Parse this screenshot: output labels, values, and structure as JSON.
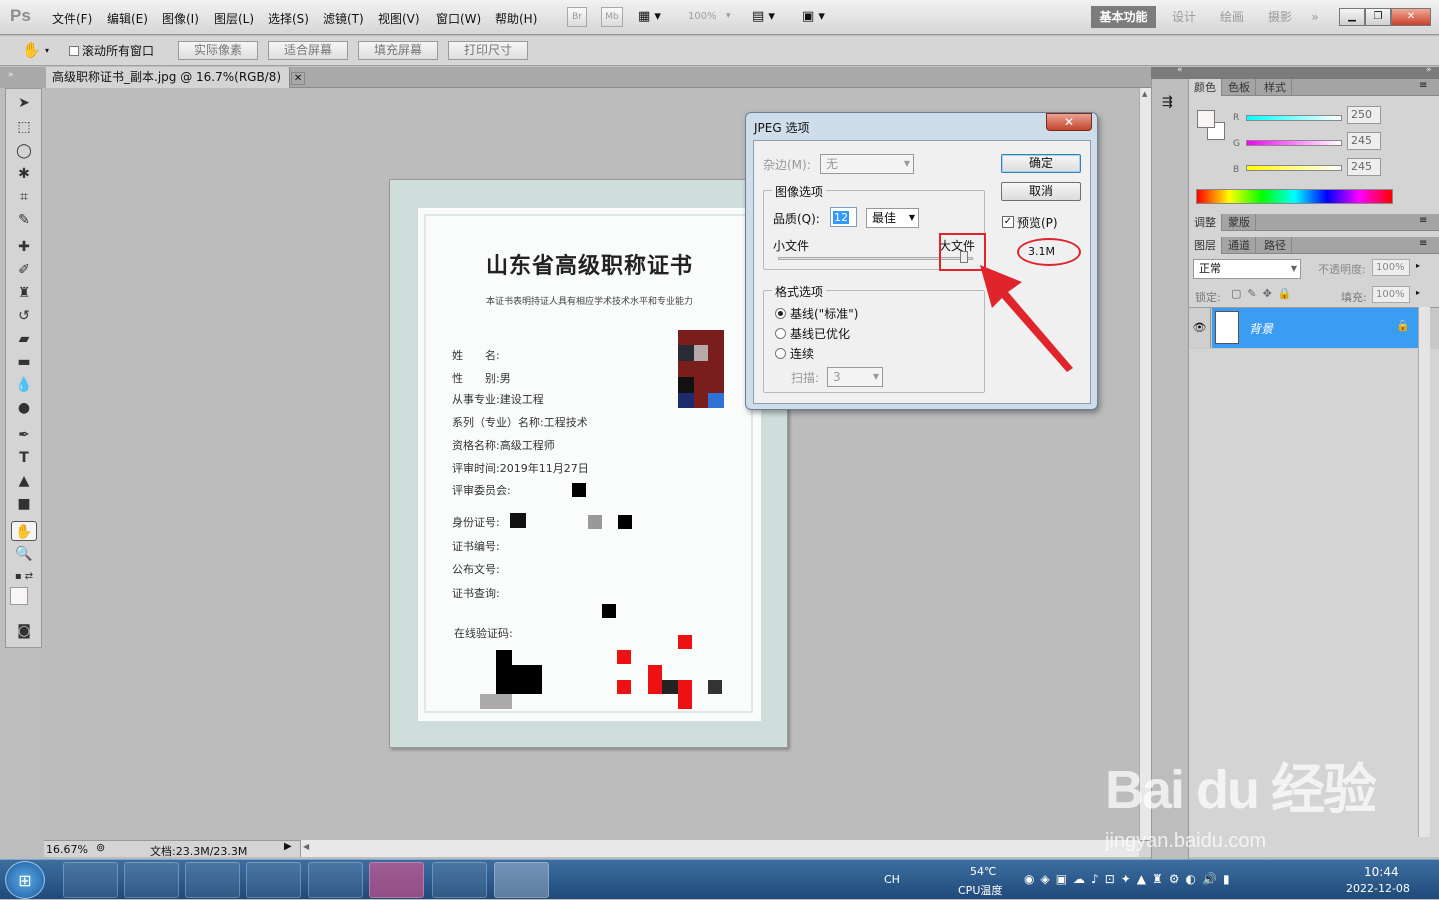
{
  "app": {
    "logo": "Ps",
    "doc_tab_title": "高级职称证书_副本.jpg @ 16.7%(RGB/8)"
  },
  "menu": [
    "文件(F)",
    "编辑(E)",
    "图像(I)",
    "图层(L)",
    "选择(S)",
    "滤镜(T)",
    "视图(V)",
    "窗口(W)",
    "帮助(H)"
  ],
  "appbar": {
    "bridge": "Br",
    "minibridge": "Mb",
    "zoom": "100%"
  },
  "workspaces": [
    "基本功能",
    "设计",
    "绘画",
    "摄影",
    "»"
  ],
  "options": {
    "scroll_all": "滚动所有窗口",
    "actual_pixels": "实际像素",
    "fit_screen": "适合屏幕",
    "fill_screen": "填充屏幕",
    "print_size": "打印尺寸"
  },
  "certificate": {
    "title": "山东省高级职称证书",
    "subtitle": "本证书表明持证人具有相应学术技术水平和专业能力",
    "fields": [
      {
        "label": "姓　　名:",
        "value": ""
      },
      {
        "label": "性　　别:",
        "value": "男"
      },
      {
        "label": "从事专业:",
        "value": "建设工程"
      },
      {
        "label": "系列（专业）名称:",
        "value": "工程技术"
      },
      {
        "label": "资格名称:",
        "value": "高级工程师"
      },
      {
        "label": "评审时间:",
        "value": "2019年11月27日"
      },
      {
        "label": "评审委员会:",
        "value": ""
      },
      {
        "label": "身份证号:",
        "value": ""
      },
      {
        "label": "证书编号:",
        "value": ""
      },
      {
        "label": "公布文号:",
        "value": ""
      },
      {
        "label": "证书查询:",
        "value": ""
      },
      {
        "label": "在线验证码:",
        "value": ""
      }
    ]
  },
  "status": {
    "zoom": "16.67%",
    "doc": "文档:23.3M/23.3M"
  },
  "panels": {
    "color_tabs": [
      "颜色",
      "色板",
      "样式"
    ],
    "rgb": [
      {
        "label": "R",
        "value": "250"
      },
      {
        "label": "G",
        "value": "245"
      },
      {
        "label": "B",
        "value": "245"
      }
    ],
    "adjust_tabs": [
      "调整",
      "蒙版"
    ],
    "layer_tabs": [
      "图层",
      "通道",
      "路径"
    ],
    "blend_mode": "正常",
    "opacity_label": "不透明度:",
    "opacity_value": "100%",
    "lock_label": "锁定:",
    "fill_label": "填充:",
    "fill_value": "100%",
    "layer_name": "背景"
  },
  "dialog": {
    "title": "JPEG 选项",
    "close": "✕",
    "matte_label": "杂边(M):",
    "matte_value": "无",
    "image_options": "图像选项",
    "quality_label": "品质(Q):",
    "quality_value": "12",
    "quality_preset": "最佳",
    "small_file": "小文件",
    "large_file": "大文件",
    "format_options": "格式选项",
    "formats": [
      "基线(\"标准\")",
      "基线已优化",
      "连续"
    ],
    "scans_label": "扫描:",
    "scans_value": "3",
    "ok": "确定",
    "cancel": "取消",
    "preview": "预览(P)",
    "file_size": "3.1M"
  },
  "taskbar": {
    "lang": "CH",
    "temperature": "54℃",
    "temp_label": "CPU温度",
    "time": "10:44",
    "date": "2022-12-08"
  },
  "watermark": {
    "brand": "Bai du 经验",
    "url": "jingyan.baidu.com"
  },
  "colors": {
    "accent_selected": "#3b9cf3",
    "annotation_red": "#e0242b",
    "dialog_frame": "#cfdcea"
  }
}
